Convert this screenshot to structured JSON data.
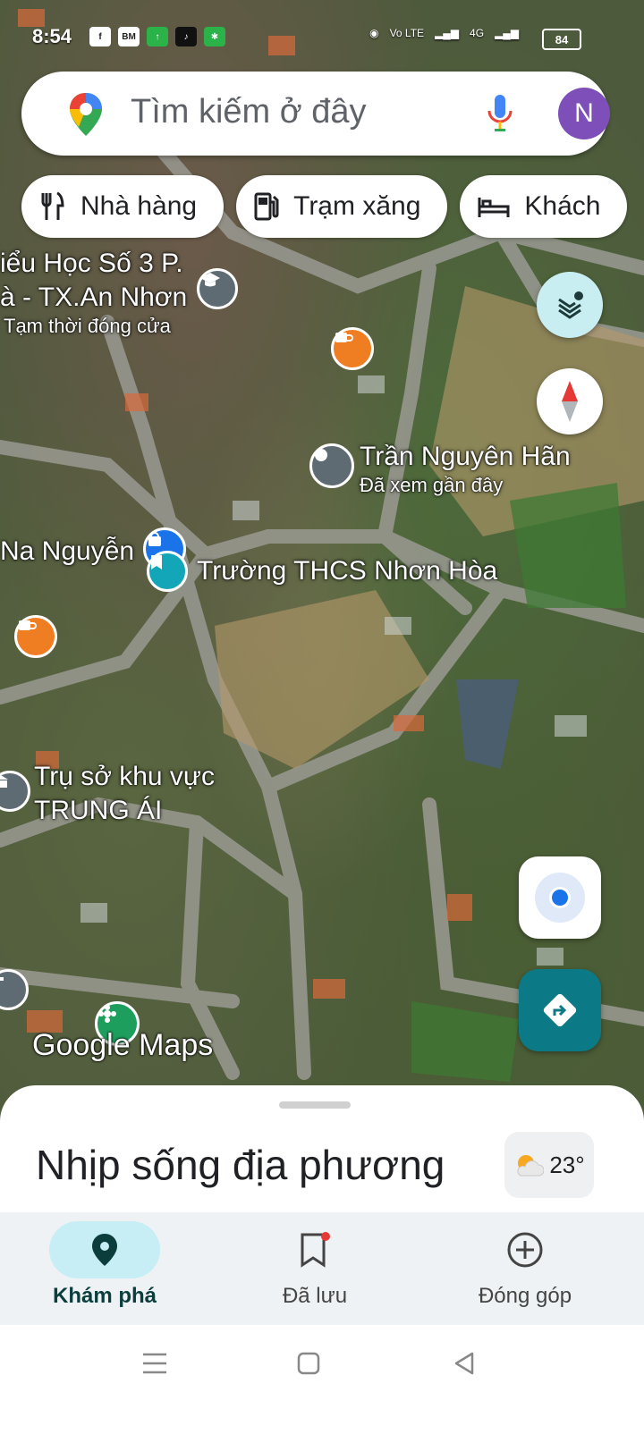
{
  "status_bar": {
    "time": "8:54",
    "battery": "84",
    "network_left": "Vo LTE",
    "network_right": "4G"
  },
  "search": {
    "placeholder": "Tìm kiếm ở đây",
    "avatar_letter": "N"
  },
  "chips": [
    {
      "label": "Nhà hàng",
      "icon": "restaurant-icon"
    },
    {
      "label": "Trạm xăng",
      "icon": "gas-station-icon"
    },
    {
      "label": "Khách",
      "icon": "hotel-icon"
    }
  ],
  "map_labels": {
    "school_top": [
      "iểu Học Số 3 P.",
      "à - TX.An Nhơn"
    ],
    "school_status": "Tạm thời đóng cửa",
    "place1_name": "Trần Nguyên Hãn",
    "place1_sub": "Đã xem gần đây",
    "place2_name": "Na Nguyễn",
    "place3_name": "Trường THCS Nhơn Hòa",
    "place4_lines": [
      "Trụ sở khu vực",
      "TRUNG ÁI"
    ],
    "branding": "Google Maps"
  },
  "sheet": {
    "title": "Nhịp sống địa phương",
    "temperature": "23°"
  },
  "nav": [
    {
      "label": "Khám phá",
      "icon": "location-pin-icon",
      "active": true
    },
    {
      "label": "Đã lưu",
      "icon": "bookmark-icon",
      "active": false
    },
    {
      "label": "Đóng góp",
      "icon": "add-circle-icon",
      "active": false
    }
  ],
  "colors": {
    "accent_teal": "#0b7a86",
    "avatar": "#7e4fb8",
    "active_pill": "#c6eef4",
    "blue_dot": "#1a73e8"
  }
}
